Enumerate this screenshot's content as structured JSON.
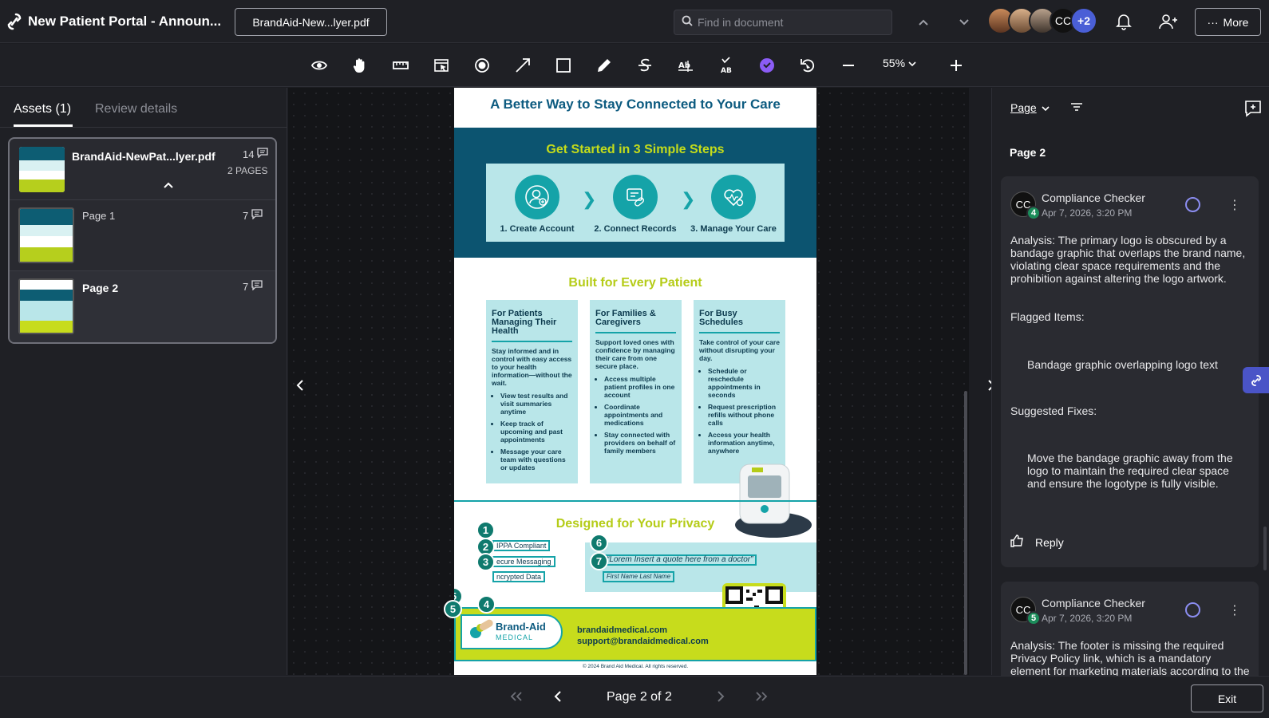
{
  "header": {
    "title": "New Patient Portal - Announ...",
    "file_chip": "BrandAid-New...lyer.pdf",
    "find_placeholder": "Find in document",
    "avatar_initials": "CC",
    "avatar_overflow": "+2",
    "more_label": "More"
  },
  "toolbar": {
    "tools": [
      "eye-icon",
      "hand-icon",
      "ruler-icon",
      "select-area-icon",
      "record-icon",
      "arrow-icon",
      "rectangle-icon",
      "pen-icon",
      "strikethrough-icon",
      "text-replace-icon",
      "spellcheck-icon",
      "check-badge-icon",
      "rotate-icon",
      "zoom-out-icon",
      "zoom-in-icon"
    ],
    "zoom": "55%"
  },
  "left_panel": {
    "tabs": [
      {
        "label": "Assets (1)",
        "active": true
      },
      {
        "label": "Review details",
        "active": false
      }
    ],
    "asset": {
      "name": "BrandAid-NewPat...lyer.pdf",
      "comment_count": "14",
      "pages_label": "2 PAGES"
    },
    "pages": [
      {
        "label": "Page 1",
        "comment_count": "7"
      },
      {
        "label": "Page 2",
        "comment_count": "7",
        "selected": true
      }
    ]
  },
  "document": {
    "headline": "A Better Way to Stay Connected to Your Care",
    "steps_title": "Get Started in 3 Simple Steps",
    "steps": [
      "1. Create Account",
      "2. Connect Records",
      "3. Manage Your Care"
    ],
    "built_title": "Built for Every Patient",
    "columns": [
      {
        "title": "For Patients Managing Their Health",
        "intro": "Stay informed and in control with easy access to your health information—without the wait.",
        "bullets": [
          "View test results and visit summaries anytime",
          "Keep track of upcoming and past appointments",
          "Message your care team with questions or updates"
        ]
      },
      {
        "title": "For Families & Caregivers",
        "intro": "Support loved ones with confidence by managing their care from one secure place.",
        "bullets": [
          "Access multiple patient profiles in one account",
          "Coordinate appointments and medications",
          "Stay connected with providers on behalf of family members"
        ]
      },
      {
        "title": "For Busy Schedules",
        "intro": "Take control of your care without disrupting your day.",
        "bullets": [
          "Schedule or reschedule appointments in seconds",
          "Request prescription refills without phone calls",
          "Access your health information anytime, anywhere"
        ]
      }
    ],
    "privacy_title": "Designed for Your Privacy",
    "privacy_items": [
      "IPPA Compliant",
      "ecure Messaging",
      "ncrypted Data"
    ],
    "quote": "“Lorem Insert a quote here from a doctor”",
    "quote_attribution": "First Name Last Name",
    "logo_brand": "Brand-Aid",
    "logo_sub": "MEDICAL",
    "contact_web": "brandaidmedical.com",
    "contact_email": "support@brandaidmedical.com",
    "copyright": "© 2024 Brand Aid Medical. All rights reserved.",
    "pins": [
      "1",
      "2",
      "3",
      "4",
      "5",
      "6",
      "7"
    ]
  },
  "right_panel": {
    "filter_label": "Page",
    "heading": "Page 2",
    "comments": [
      {
        "author": "Compliance Checker",
        "initials": "CC",
        "badge": "4",
        "date": "Apr 7, 2026, 3:20 PM",
        "analysis": "Analysis: The primary logo is obscured by a bandage graphic that overlaps the brand name, violating clear space requirements and the prohibition against altering the logo artwork.",
        "flagged_label": "Flagged Items:",
        "flagged": "Bandage graphic overlapping logo text",
        "fixes_label": "Suggested Fixes:",
        "fixes": "Move the bandage graphic away from the logo to maintain the required clear space and ensure the logotype is fully visible.",
        "reply_label": "Reply"
      },
      {
        "author": "Compliance Checker",
        "initials": "CC",
        "badge": "5",
        "date": "Apr 7, 2026, 3:20 PM",
        "analysis": "Analysis: The footer is missing the required Privacy Policy link, which is a mandatory element for marketing materials according to the brand guidelines."
      }
    ]
  },
  "footer": {
    "page_indicator": "Page 2 of 2",
    "exit_label": "Exit"
  }
}
